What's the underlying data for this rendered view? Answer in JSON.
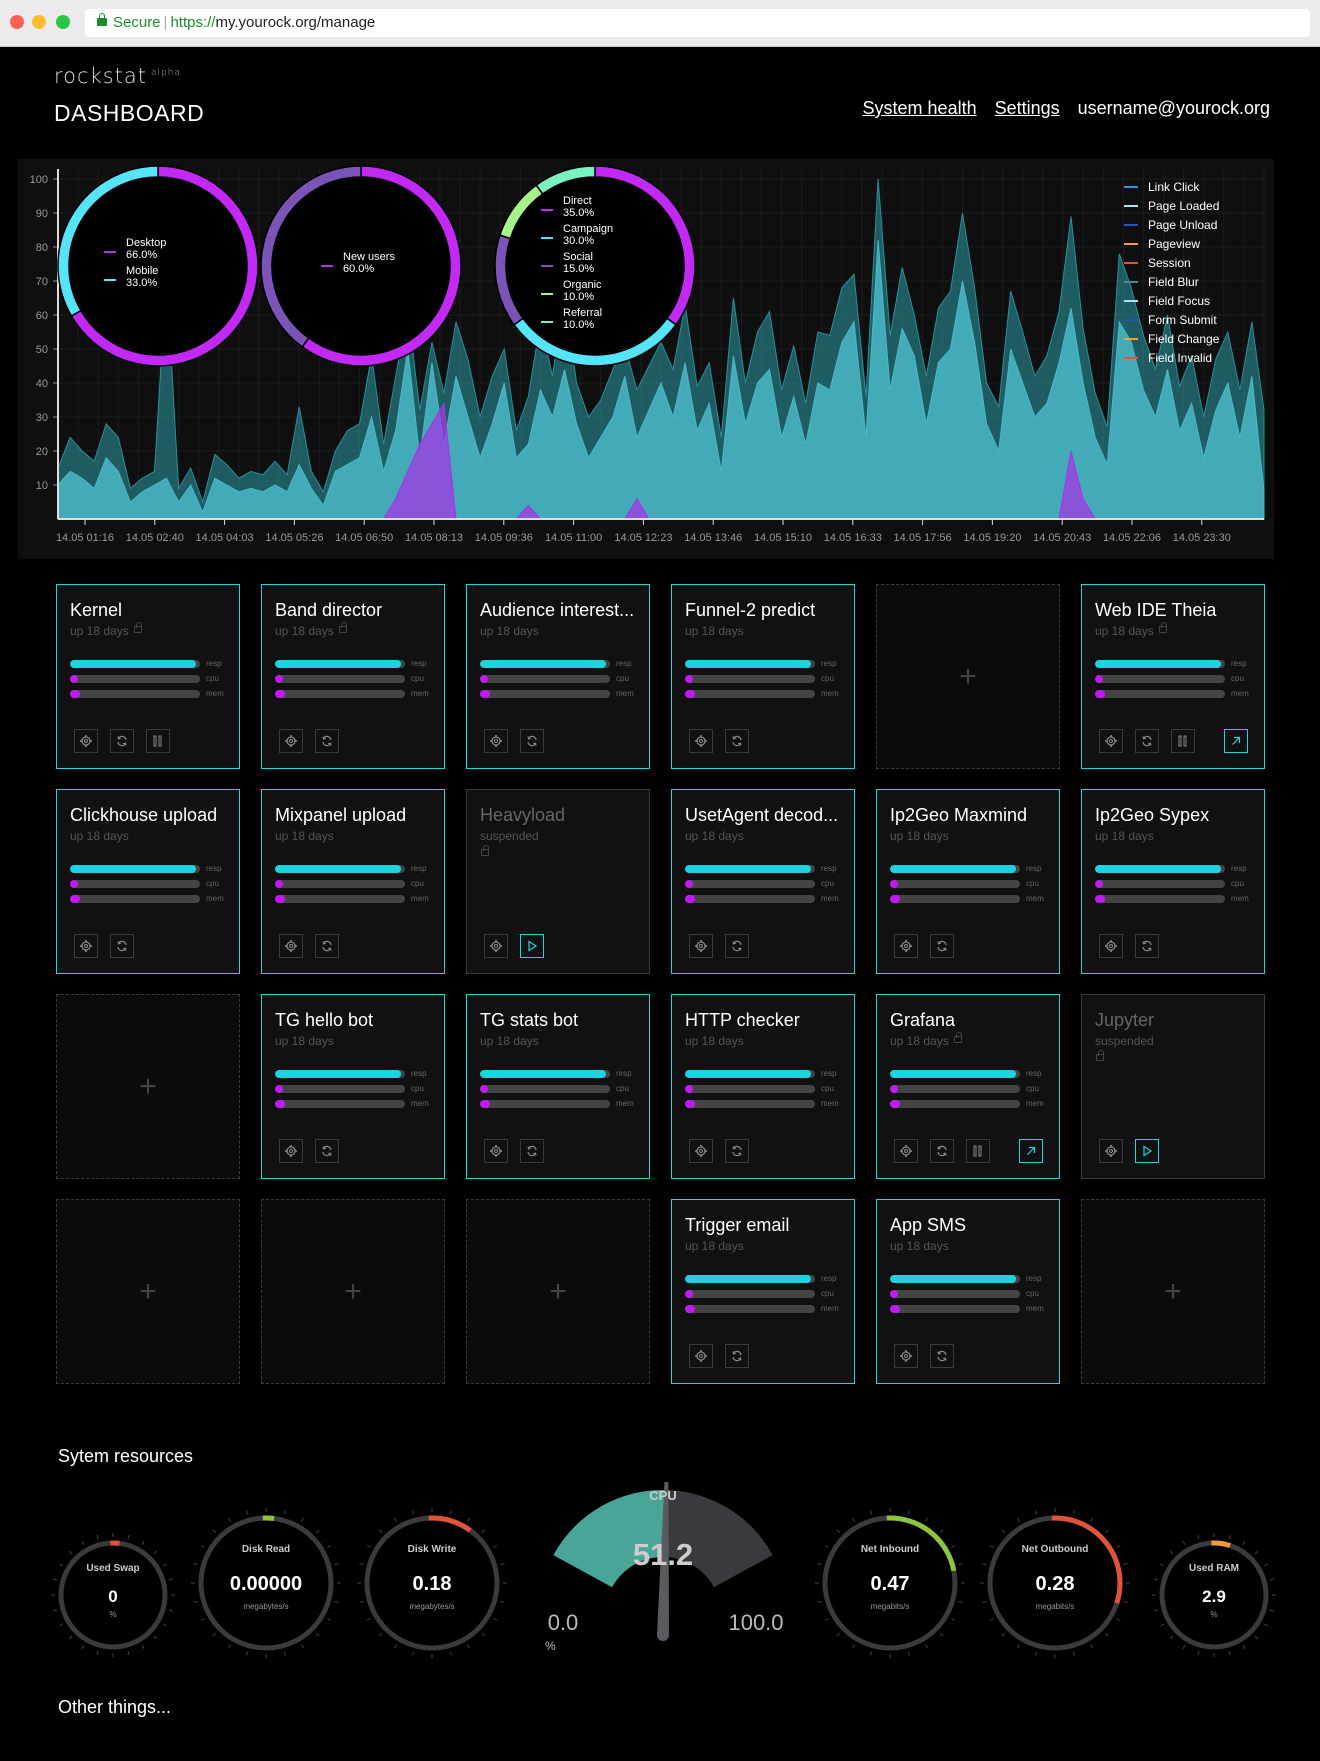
{
  "browser": {
    "secure_label": "Secure",
    "url_scheme": "https://",
    "url_rest": "my.yourock.org/manage"
  },
  "header": {
    "logo": "rockstat",
    "logo_tag": "alpha",
    "title": "DASHBOARD",
    "nav": {
      "health": "System health",
      "settings": "Settings",
      "user": "username@yourock.org"
    }
  },
  "chart_data": {
    "type": "area",
    "ylim": [
      0,
      100
    ],
    "yticks": [
      10,
      20,
      30,
      40,
      50,
      60,
      70,
      80,
      90,
      100
    ],
    "xticks": [
      "14.05 01:16",
      "14.05 02:40",
      "14.05 04:03",
      "14.05 05:26",
      "14.05 06:50",
      "14.05 08:13",
      "14.05 09:36",
      "14.05 11:00",
      "14.05 12:23",
      "14.05 13:46",
      "14.05 15:10",
      "14.05 16:33",
      "14.05 17:56",
      "14.05 19:20",
      "14.05 20:43",
      "14.05 22:06",
      "14.05 23:30"
    ],
    "legend": [
      {
        "name": "Link Click",
        "color": "#3a8fd6"
      },
      {
        "name": "Page Loaded",
        "color": "#a8e4f2"
      },
      {
        "name": "Page Unload",
        "color": "#2a52b8"
      },
      {
        "name": "Pageview",
        "color": "#f29a4a"
      },
      {
        "name": "Session",
        "color": "#e2533a"
      },
      {
        "name": "Field Blur",
        "color": "#4a8a94"
      },
      {
        "name": "Field Focus",
        "color": "#a8e4f2"
      },
      {
        "name": "Form Submit",
        "color": "#2a52b8"
      },
      {
        "name": "Field Change",
        "color": "#f2a23a"
      },
      {
        "name": "Field Invalid",
        "color": "#e2533a"
      }
    ],
    "series": [
      {
        "color": "#2a8f9a",
        "values": [
          15,
          24,
          20,
          17,
          28,
          24,
          9,
          12,
          14,
          72,
          9,
          15,
          5,
          19,
          16,
          12,
          14,
          13,
          17,
          13,
          33,
          14,
          8,
          20,
          26,
          28,
          48,
          22,
          42,
          62,
          32,
          52,
          37,
          58,
          47,
          30,
          42,
          50,
          26,
          36,
          58,
          42,
          66,
          40,
          30,
          35,
          44,
          51,
          38,
          45,
          52,
          44,
          63,
          39,
          46,
          24,
          65,
          40,
          55,
          61,
          38,
          51,
          34,
          55,
          54,
          68,
          72,
          36,
          100,
          54,
          74,
          60,
          42,
          62,
          67,
          90,
          68,
          40,
          33,
          67,
          55,
          42,
          48,
          61,
          89,
          56,
          37,
          27,
          78,
          68,
          54,
          44,
          60,
          39,
          48,
          30,
          47,
          55,
          38,
          58,
          32
        ]
      },
      {
        "color": "#4ab8c8",
        "values": [
          10,
          14,
          12,
          9,
          18,
          14,
          5,
          8,
          10,
          12,
          5,
          10,
          2,
          12,
          10,
          8,
          9,
          8,
          10,
          8,
          16,
          9,
          4,
          14,
          16,
          18,
          30,
          14,
          26,
          50,
          18,
          46,
          22,
          42,
          30,
          18,
          28,
          40,
          18,
          22,
          38,
          30,
          44,
          28,
          18,
          24,
          30,
          42,
          24,
          32,
          40,
          30,
          46,
          26,
          34,
          14,
          48,
          28,
          40,
          44,
          24,
          36,
          22,
          40,
          38,
          52,
          58,
          24,
          82,
          38,
          56,
          48,
          28,
          46,
          50,
          70,
          52,
          28,
          20,
          50,
          40,
          30,
          34,
          46,
          62,
          40,
          24,
          16,
          58,
          52,
          38,
          30,
          44,
          26,
          34,
          18,
          32,
          40,
          24,
          42,
          8
        ]
      },
      {
        "color": "#a236e6",
        "values": [
          0,
          0,
          0,
          0,
          0,
          0,
          0,
          0,
          0,
          0,
          0,
          0,
          0,
          0,
          0,
          0,
          0,
          0,
          0,
          0,
          0,
          0,
          0,
          0,
          0,
          0,
          0,
          0,
          6,
          14,
          22,
          28,
          34,
          0,
          0,
          0,
          0,
          0,
          0,
          4,
          0,
          0,
          0,
          0,
          0,
          0,
          0,
          0,
          6,
          0,
          0,
          0,
          0,
          0,
          0,
          0,
          0,
          0,
          0,
          0,
          0,
          0,
          0,
          0,
          0,
          0,
          0,
          0,
          0,
          0,
          0,
          0,
          0,
          0,
          0,
          0,
          0,
          0,
          0,
          0,
          0,
          0,
          0,
          0,
          20,
          6,
          0,
          0,
          0,
          0,
          0,
          0,
          0,
          0,
          0,
          0,
          0,
          0,
          0,
          0,
          0
        ]
      }
    ],
    "donuts": [
      {
        "slices": [
          {
            "label": "Desktop",
            "value": 66.0,
            "text": "66.0%",
            "color": "#c229f4"
          },
          {
            "label": "Mobile",
            "value": 33.0,
            "text": "33.0%",
            "color": "#56e4f8"
          }
        ]
      },
      {
        "slices": [
          {
            "label": "New users",
            "value": 60.0,
            "text": "60.0%",
            "color": "#c229f4"
          },
          {
            "label": "",
            "value": 40.0,
            "text": "",
            "color": "#7b54b8"
          }
        ]
      },
      {
        "slices": [
          {
            "label": "Direct",
            "value": 35.0,
            "text": "35.0%",
            "color": "#c229f4"
          },
          {
            "label": "Campaign",
            "value": 30.0,
            "text": "30.0%",
            "color": "#56e4f8"
          },
          {
            "label": "Social",
            "value": 15.0,
            "text": "15.0%",
            "color": "#7b54b8"
          },
          {
            "label": "Organic",
            "value": 10.0,
            "text": "10.0%",
            "color": "#a8f28a"
          },
          {
            "label": "Referral",
            "value": 10.0,
            "text": "10.0%",
            "color": "#7af2c0"
          }
        ]
      }
    ]
  },
  "bar_labels": {
    "resp": "resp",
    "cpu": "cpu",
    "mem": "mem"
  },
  "cards": [
    {
      "kind": "app",
      "title": "Kernel",
      "status": "up 18 days",
      "locked": true,
      "resp": 0.97,
      "cpu": 0.05,
      "mem": 0.08,
      "pause": true,
      "external": false
    },
    {
      "kind": "app",
      "title": "Band director",
      "status": "up 18 days",
      "locked": true,
      "resp": 0.97,
      "cpu": 0.05,
      "mem": 0.08,
      "pause": false,
      "external": false
    },
    {
      "kind": "app",
      "title": "Audience interest...",
      "status": "up 18 days",
      "locked": false,
      "resp": 0.97,
      "cpu": 0.05,
      "mem": 0.08,
      "pause": false,
      "external": false
    },
    {
      "kind": "app",
      "title": "Funnel-2 predict",
      "status": "up 18 days",
      "locked": false,
      "resp": 0.97,
      "cpu": 0.05,
      "mem": 0.08,
      "pause": false,
      "external": false
    },
    {
      "kind": "empty"
    },
    {
      "kind": "app",
      "title": "Web IDE Theia",
      "status": "up 18 days",
      "locked": true,
      "resp": 0.97,
      "cpu": 0.05,
      "mem": 0.08,
      "pause": true,
      "external": true
    },
    {
      "kind": "app",
      "title": "Clickhouse upload",
      "status": "up 18 days",
      "locked": false,
      "resp": 0.97,
      "cpu": 0.05,
      "mem": 0.08,
      "pause": false,
      "external": false
    },
    {
      "kind": "app",
      "title": "Mixpanel upload",
      "status": "up 18 days",
      "locked": false,
      "resp": 0.97,
      "cpu": 0.05,
      "mem": 0.08,
      "pause": false,
      "external": false
    },
    {
      "kind": "suspended",
      "title": "Heavyload",
      "status": "suspended",
      "gear": true
    },
    {
      "kind": "app",
      "title": "UsetAgent decod...",
      "status": "up 18 days",
      "locked": false,
      "resp": 0.97,
      "cpu": 0.05,
      "mem": 0.08,
      "pause": false,
      "external": false
    },
    {
      "kind": "app",
      "title": "Ip2Geo Maxmind",
      "status": "up 18 days",
      "locked": false,
      "resp": 0.97,
      "cpu": 0.05,
      "mem": 0.08,
      "pause": false,
      "external": false
    },
    {
      "kind": "app",
      "title": "Ip2Geo Sypex",
      "status": "up 18 days",
      "locked": false,
      "resp": 0.97,
      "cpu": 0.05,
      "mem": 0.08,
      "pause": false,
      "external": false
    },
    {
      "kind": "empty"
    },
    {
      "kind": "app",
      "title": "TG hello bot",
      "status": "up 18 days",
      "locked": false,
      "resp": 0.97,
      "cpu": 0.05,
      "mem": 0.08,
      "pause": false,
      "external": false
    },
    {
      "kind": "app",
      "title": "TG stats bot",
      "status": "up 18 days",
      "locked": false,
      "resp": 0.97,
      "cpu": 0.05,
      "mem": 0.08,
      "pause": false,
      "external": false
    },
    {
      "kind": "app",
      "title": "HTTP checker",
      "status": "up 18 days",
      "locked": false,
      "resp": 0.97,
      "cpu": 0.05,
      "mem": 0.08,
      "pause": false,
      "external": false
    },
    {
      "kind": "app",
      "title": "Grafana",
      "status": "up 18 days",
      "locked": true,
      "resp": 0.97,
      "cpu": 0.05,
      "mem": 0.08,
      "pause": true,
      "external": true
    },
    {
      "kind": "suspended",
      "title": "Jupyter",
      "status": "suspended",
      "gear": true
    },
    {
      "kind": "empty"
    },
    {
      "kind": "empty"
    },
    {
      "kind": "empty"
    },
    {
      "kind": "app",
      "title": "Trigger email",
      "status": "up 18 days",
      "locked": false,
      "resp": 0.97,
      "cpu": 0.05,
      "mem": 0.08,
      "pause": false,
      "external": false
    },
    {
      "kind": "app",
      "title": "App SMS",
      "status": "up 18 days",
      "locked": false,
      "resp": 0.97,
      "cpu": 0.05,
      "mem": 0.08,
      "pause": false,
      "external": false
    },
    {
      "kind": "empty"
    }
  ],
  "resources": {
    "title": "Sytem resources",
    "gauges": [
      {
        "label": "Used Swap",
        "value": "0",
        "unit": "%",
        "level": 0.0,
        "color": "#e2533a",
        "small": true
      },
      {
        "label": "Disk Read",
        "value": "0.00000",
        "unit": "megabytes/s",
        "level": 0.0,
        "color": "#8cc63f",
        "small": false
      },
      {
        "label": "Disk Write",
        "value": "0.18",
        "unit": "megabytes/s",
        "level": 0.1,
        "color": "#e2533a",
        "small": false
      },
      {
        "label": "Net Inbound",
        "value": "0.47",
        "unit": "megabits/s",
        "level": 0.22,
        "color": "#8cc63f",
        "small": false
      },
      {
        "label": "Net Outbound",
        "value": "0.28",
        "unit": "megabits/s",
        "level": 0.3,
        "color": "#e2533a",
        "small": false
      },
      {
        "label": "Used RAM",
        "value": "2.9",
        "unit": "%",
        "level": 0.05,
        "color": "#f29a3a",
        "small": true
      }
    ],
    "cpu": {
      "label": "CPU",
      "value": "51.2",
      "min": "0.0",
      "max": "100.0",
      "unit": "%",
      "level": 0.512
    }
  },
  "other": "Other things..."
}
